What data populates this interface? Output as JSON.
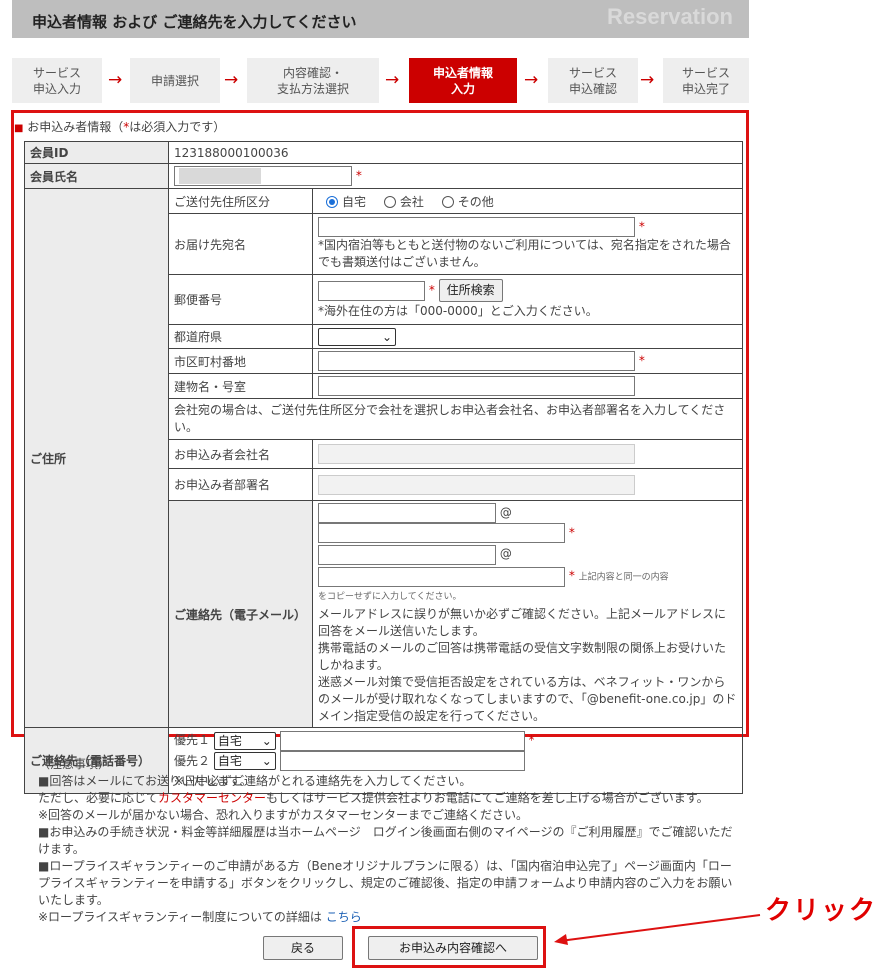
{
  "header": {
    "title": "申込者情報 および ご連絡先を入力してください",
    "watermark": "Reservation"
  },
  "steps": [
    {
      "label": "サービス\n申込入力",
      "active": false
    },
    {
      "label": "申請選択",
      "active": false
    },
    {
      "label": "内容確認・\n支払方法選択",
      "active": false
    },
    {
      "label": "申込者情報\n入力",
      "active": true
    },
    {
      "label": "サービス\n申込確認",
      "active": false
    },
    {
      "label": "サービス\n申込完了",
      "active": false
    }
  ],
  "step_arrow": "→",
  "form": {
    "section_title_prefix": "お申込み者情報（",
    "required_mark": "*",
    "section_title_suffix": "は必須入力です）",
    "member_id_label": "会員ID",
    "member_id": "123188000100036",
    "member_name_label": "会員氏名",
    "address": {
      "label": "ご住所",
      "shipping_type_label": "ご送付先住所区分",
      "options": [
        "自宅",
        "会社",
        "その他"
      ],
      "selected": "自宅",
      "recipient_label": "お届け先宛名",
      "recipient_note": "*国内宿泊等もともと送付物のないご利用については、宛名指定をされた場合でも書類送付はございません。",
      "zip_label": "郵便番号",
      "zip_button": "住所検索",
      "zip_note": "*海外在住の方は「000-0000」とご入力ください。",
      "prefecture_label": "都道府県",
      "city_label": "市区町村番地",
      "building_label": "建物名・号室",
      "company_note": "会社宛の場合は、ご送付先住所区分で会社を選択しお申込者会社名、お申込者部署名を入力してください。",
      "company_label": "お申込み者会社名",
      "dept_label": "お申込み者部署名"
    },
    "email": {
      "label": "ご連絡先（電子メール）",
      "at": "@",
      "same_note_1": "上記内容と同一の内容",
      "same_note_2": "をコピーせずに入力してください。",
      "note_1": "メールアドレスに誤りが無いか必ずご確認ください。上記メールアドレスに回答をメール送信いたします。",
      "note_2": "携帯電話のメールのご回答は携帯電話の受信文字数制限の関係上お受けいたしかねます。",
      "note_3": "迷惑メール対策で受信拒否設定をされている方は、ベネフィット・ワンからのメールが受け取れなくなってしまいますので、「@benefit-one.co.jp」のドメイン指定受信の設定を行ってください。"
    },
    "phone": {
      "label": "ご連絡先（電話番号）",
      "priority_1": "優先１",
      "priority_2": "優先２",
      "type_1": "自宅",
      "type_2": "自宅",
      "note": "※日中必ずご連絡がとれる連絡先を入力してください。"
    }
  },
  "notes": {
    "heading": "（注意事項）",
    "line_1": "■回答はメールにてお送りいたします。",
    "line_2_pre": "ただし、必要に応じて",
    "line_2_link": "カスタマーセンター",
    "line_2_post": "もしくはサービス提供会社よりお電話にてご連絡を差し上げる場合がございます。",
    "line_3": "※回答のメールが届かない場合、恐れ入りますがカスタマーセンターまでご連絡ください。",
    "line_4": "■お申込みの手続き状況・料金等詳細履歴は当ホームページ　ログイン後画面右側のマイページの『ご利用履歴』でご確認いただけます。",
    "line_5": "■ロープライスギャランティーのご申請がある方（Beneオリジナルプランに限る）は、「国内宿泊申込完了」ページ画面内「ロープライスギャランティーを申請する」ボタンをクリックし、規定のご確認後、指定の申請フォームより申請内容のご入力をお願いいたします。",
    "line_6_pre": "※ロープライスギャランティー制度についての詳細は ",
    "line_6_link": "こちら"
  },
  "buttons": {
    "back": "戻る",
    "confirm": "お申込み内容確認へ"
  },
  "annotation": {
    "click_label": "クリック"
  },
  "colors": {
    "accent": "#cc0000",
    "highlight": "#dd1111",
    "link": "#1a5fb4"
  }
}
